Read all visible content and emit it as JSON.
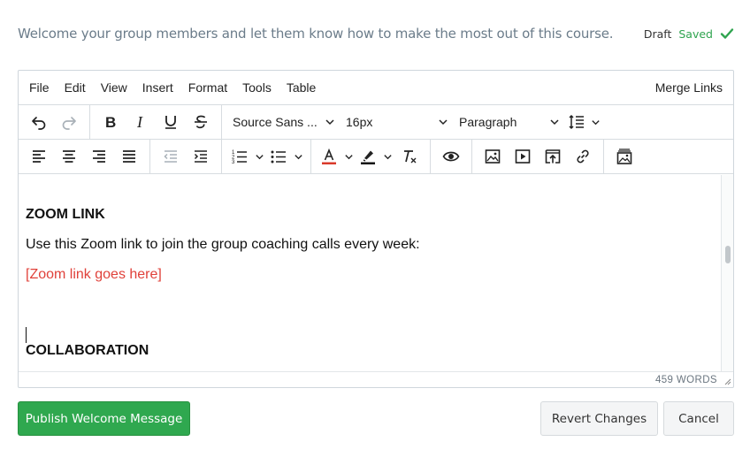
{
  "header": {
    "description": "Welcome your group members and let them know how to make the most out of this course.",
    "draft_label": "Draft",
    "saved_label": "Saved",
    "saved_color": "#2fa44f"
  },
  "menubar": {
    "items": [
      "File",
      "Edit",
      "View",
      "Insert",
      "Format",
      "Tools",
      "Table"
    ],
    "merge_links": "Merge Links"
  },
  "toolbar": {
    "font_family": "Source Sans ...",
    "font_size": "16px",
    "block_format": "Paragraph",
    "text_color": "#d93a2b",
    "highlight_color": "#111111",
    "icons_row1": [
      "undo-icon",
      "redo-icon",
      "bold-icon",
      "italic-icon",
      "underline-icon",
      "strikethrough-icon",
      "line-height-icon"
    ],
    "icons_row2": [
      "align-left-icon",
      "align-center-icon",
      "align-right-icon",
      "align-justify-icon",
      "outdent-icon",
      "indent-icon",
      "numbered-list-icon",
      "bullet-list-icon",
      "text-color-icon",
      "highlight-icon",
      "clear-formatting-icon",
      "preview-icon",
      "image-icon",
      "video-icon",
      "embed-icon",
      "link-icon",
      "gallery-icon"
    ]
  },
  "content": {
    "zoom_heading": "ZOOM LINK",
    "zoom_text": "Use this Zoom link to join the group coaching calls every week:",
    "zoom_link": "[Zoom link goes here]",
    "collab_heading": "COLLABORATION",
    "link_color": "#e0413a"
  },
  "statusbar": {
    "word_count": "459 WORDS"
  },
  "actions": {
    "publish": "Publish Welcome Message",
    "revert": "Revert Changes",
    "cancel": "Cancel",
    "publish_color": "#2fa84f"
  }
}
